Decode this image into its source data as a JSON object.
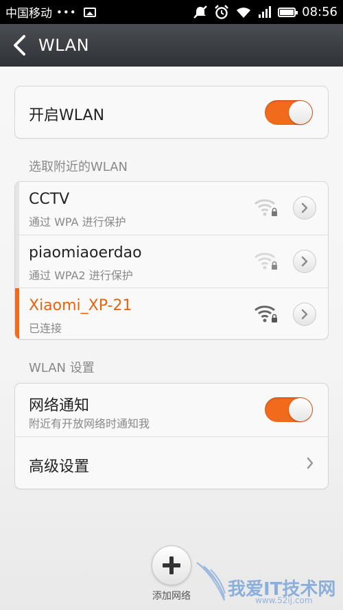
{
  "status_bar": {
    "carrier": "中国移动",
    "dots": "•••",
    "time": "08:56"
  },
  "header": {
    "title": "WLAN"
  },
  "wlan_toggle": {
    "label": "开启WLAN",
    "on": true
  },
  "nearby": {
    "section_title": "选取附近的WLAN",
    "networks": [
      {
        "name": "CCTV",
        "status": "通过 WPA 进行保护",
        "connected": false
      },
      {
        "name": "piaomiaoerdao",
        "status": "通过 WPA2 进行保护",
        "connected": false
      },
      {
        "name": "Xiaomi_XP-21",
        "status": "已连接",
        "connected": true
      }
    ]
  },
  "settings": {
    "section_title": "WLAN 设置",
    "notify": {
      "label": "网络通知",
      "sublabel": "附近有开放网络时通知我",
      "on": true
    },
    "advanced": {
      "label": "高级设置"
    }
  },
  "footer": {
    "add_label": "添加网络"
  },
  "watermark": {
    "text": "我爱IT技术网",
    "url": "www.52ij.com"
  },
  "colors": {
    "accent": "#f26a1b",
    "titlebar": "#3a3d41",
    "connected_text": "#e8630e"
  },
  "icons": [
    "back-arrow-icon",
    "wifi-lock-icon",
    "chevron-right-icon",
    "plus-icon",
    "mute-icon",
    "alarm-icon",
    "signal-icon",
    "battery-icon",
    "image-icon"
  ]
}
